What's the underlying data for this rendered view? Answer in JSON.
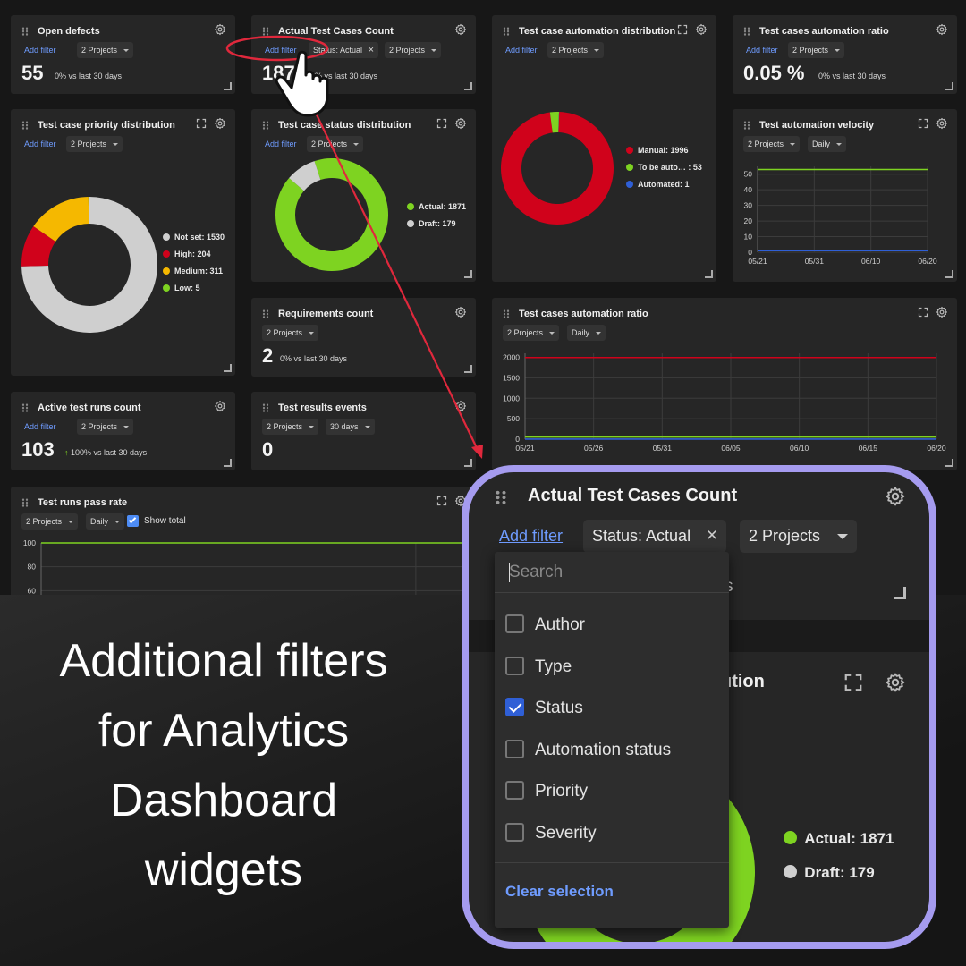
{
  "common": {
    "add_filter": "Add filter",
    "projects": "2 Projects",
    "daily": "Daily"
  },
  "w_open_defects": {
    "title": "Open defects",
    "value": "55",
    "delta": "0% vs last 30 days"
  },
  "w_actual": {
    "title": "Actual Test Cases Count",
    "status_chip": "Status: Actual",
    "value": "1871",
    "delta": "0% vs last 30 days"
  },
  "w_auto_dist": {
    "title": "Test case automation distribution",
    "legend": [
      {
        "label": "Manual: 1996",
        "color": "#d0021b"
      },
      {
        "label": "To be auto…  : 53",
        "color": "#7ed321"
      },
      {
        "label": "Automated: 1",
        "color": "#2f5fd6"
      }
    ]
  },
  "w_ratio_top": {
    "title": "Test cases automation ratio",
    "value": "0.05 %",
    "delta": "0% vs last 30 days"
  },
  "w_priority": {
    "title": "Test case priority distribution",
    "legend": [
      {
        "label": "Not set: 1530",
        "color": "#cfcfcf"
      },
      {
        "label": "High: 204",
        "color": "#d0021b"
      },
      {
        "label": "Medium: 311",
        "color": "#f5b800"
      },
      {
        "label": "Low: 5",
        "color": "#7ed321"
      }
    ]
  },
  "w_status": {
    "title": "Test case status distribution",
    "legend": [
      {
        "label": "Actual: 1871",
        "color": "#7ed321"
      },
      {
        "label": "Draft: 179",
        "color": "#cfcfcf"
      }
    ]
  },
  "w_velocity": {
    "title": "Test automation velocity"
  },
  "w_requirements": {
    "title": "Requirements count",
    "value": "2",
    "delta": "0% vs last 30 days"
  },
  "w_ratio_chart": {
    "title": "Test cases automation ratio"
  },
  "w_active_runs": {
    "title": "Active test runs count",
    "value": "103",
    "delta": "100% vs last 30 days",
    "delta_arrow": "↑"
  },
  "w_results_events": {
    "title": "Test results events",
    "period": "30 days",
    "value": "0"
  },
  "w_pass_rate": {
    "title": "Test runs pass rate",
    "show_total": "Show total"
  },
  "headline": [
    "Additional filters",
    "for Analytics",
    "Dashboard",
    "widgets"
  ],
  "zoom": {
    "title": "Actual Test Cases Count",
    "add_filter": "Add filter",
    "status_chip": "Status: Actual",
    "projects": "2 Projects",
    "partial_title": "ution",
    "partial_s": "s",
    "legend": [
      {
        "label": "Actual: 1871",
        "color": "#7ed321"
      },
      {
        "label": "Draft: 179",
        "color": "#cfcfcf"
      }
    ],
    "dropdown": {
      "search_placeholder": "Search",
      "options": [
        {
          "label": "Author",
          "checked": false
        },
        {
          "label": "Type",
          "checked": false
        },
        {
          "label": "Status",
          "checked": true
        },
        {
          "label": "Automation status",
          "checked": false
        },
        {
          "label": "Priority",
          "checked": false
        },
        {
          "label": "Severity",
          "checked": false
        }
      ],
      "clear": "Clear selection"
    }
  },
  "chart_data": [
    {
      "type": "pie",
      "title": "Test case automation distribution",
      "categories": [
        "Manual",
        "To be automated",
        "Automated"
      ],
      "values": [
        1996,
        53,
        1
      ],
      "colors": [
        "#d0021b",
        "#7ed321",
        "#2f5fd6"
      ]
    },
    {
      "type": "pie",
      "title": "Test case priority distribution",
      "categories": [
        "Not set",
        "High",
        "Medium",
        "Low"
      ],
      "values": [
        1530,
        204,
        311,
        5
      ],
      "colors": [
        "#cfcfcf",
        "#d0021b",
        "#f5b800",
        "#7ed321"
      ]
    },
    {
      "type": "pie",
      "title": "Test case status distribution",
      "categories": [
        "Actual",
        "Draft"
      ],
      "values": [
        1871,
        179
      ],
      "colors": [
        "#7ed321",
        "#cfcfcf"
      ]
    },
    {
      "type": "line",
      "title": "Test automation velocity",
      "x": [
        "05/21",
        "05/31",
        "06/10",
        "06/20"
      ],
      "ylim": [
        0,
        55
      ],
      "yticks": [
        0,
        10,
        20,
        30,
        40,
        50
      ],
      "series": [
        {
          "color": "#7ed321",
          "values": [
            53,
            53,
            53,
            53
          ]
        },
        {
          "color": "#2f5fd6",
          "values": [
            1,
            1,
            1,
            1
          ]
        }
      ]
    },
    {
      "type": "line",
      "title": "Test cases automation ratio",
      "x": [
        "05/21",
        "05/26",
        "05/31",
        "06/05",
        "06/10",
        "06/15",
        "06/20"
      ],
      "ylim": [
        0,
        2100
      ],
      "yticks": [
        0,
        500,
        1000,
        1500,
        2000
      ],
      "series": [
        {
          "color": "#d0021b",
          "values": [
            1996,
            1996,
            1996,
            1996,
            1996,
            1996,
            1996
          ]
        },
        {
          "color": "#7ed321",
          "values": [
            53,
            53,
            53,
            53,
            53,
            53,
            53
          ]
        },
        {
          "color": "#2f5fd6",
          "values": [
            1,
            1,
            1,
            1,
            1,
            1,
            1
          ]
        }
      ]
    },
    {
      "type": "line",
      "title": "Test runs pass rate",
      "ylim": [
        40,
        100
      ],
      "yticks": [
        60,
        80,
        100
      ],
      "series": [
        {
          "color": "#7ed321",
          "values": [
            100,
            100,
            100
          ]
        }
      ]
    }
  ]
}
